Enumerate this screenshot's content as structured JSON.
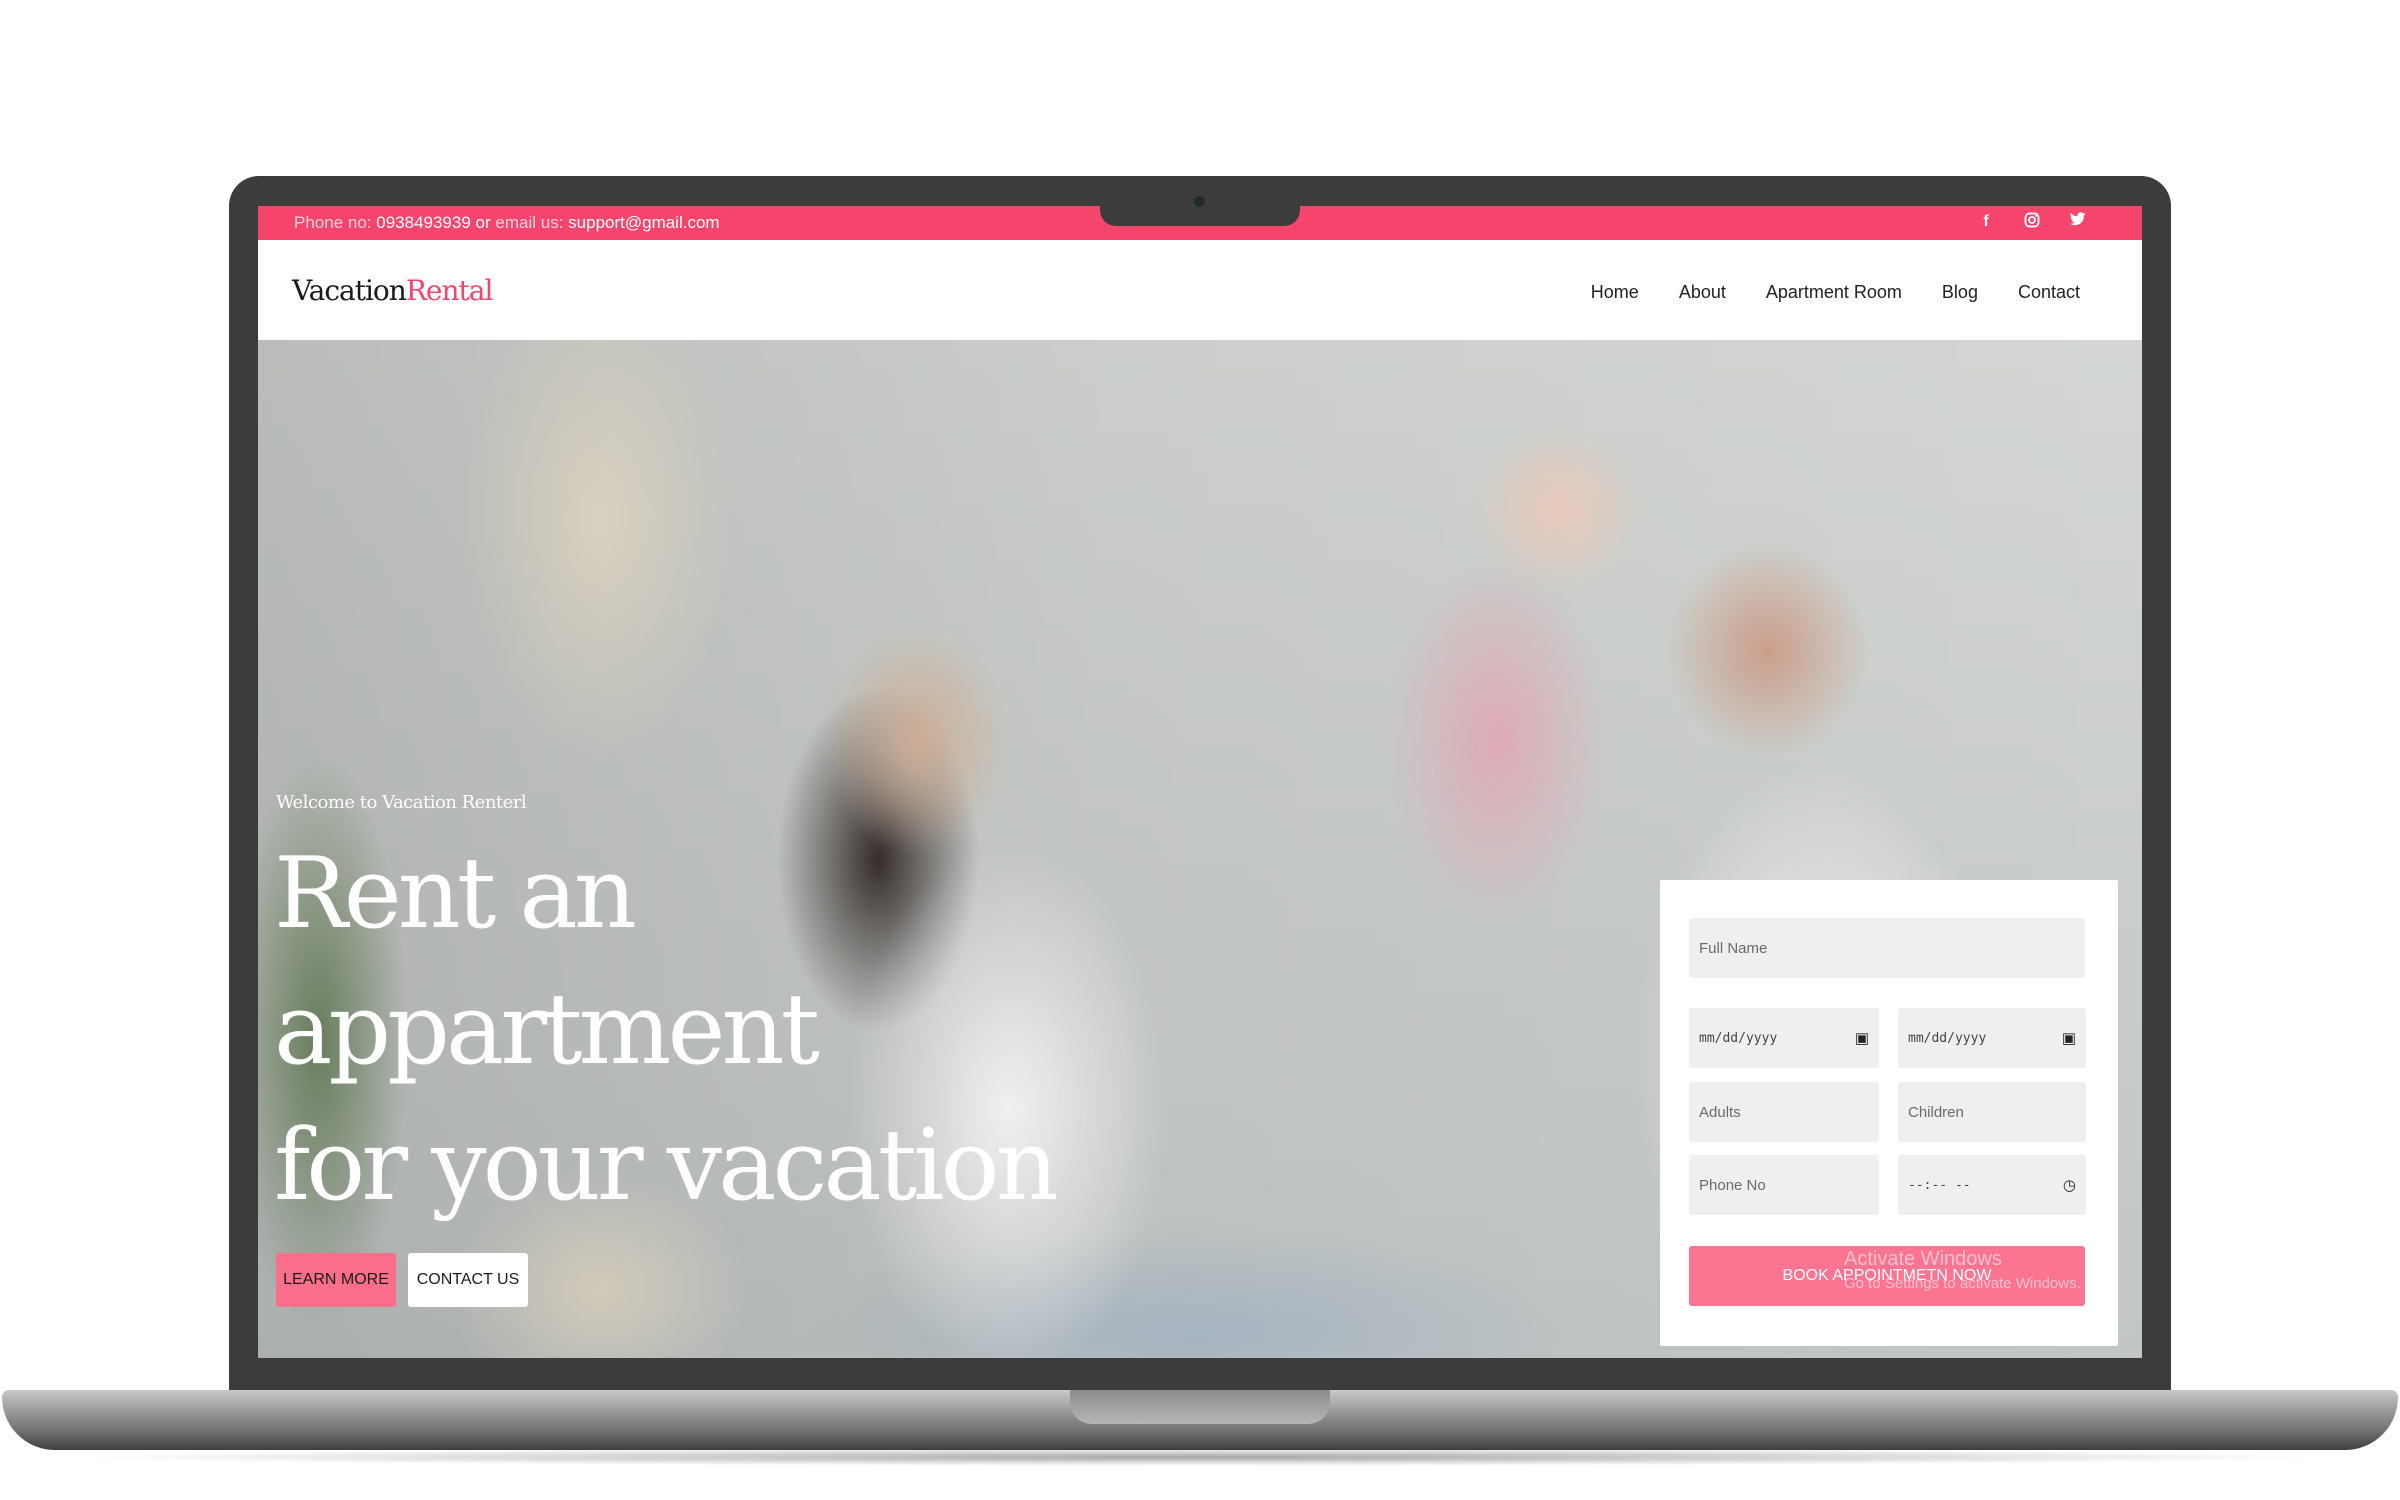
{
  "topbar": {
    "phone_label": "Phone no:",
    "phone": "0938493939",
    "or_text": "or",
    "email_label": "email us:",
    "email": "support@gmail.com",
    "social": [
      "facebook-icon",
      "instagram-icon",
      "twitter-icon"
    ]
  },
  "header": {
    "logo_main": "Vacation",
    "logo_accent": "Rental",
    "nav": [
      "Home",
      "About",
      "Apartment Room",
      "Blog",
      "Contact"
    ]
  },
  "hero": {
    "welcome": "Welcome to Vacation Renterl",
    "headline_line1": "Rent an appartment",
    "headline_line2": "for your vacation",
    "learn_more": "LEARN MORE",
    "contact_us": "CONTACT US"
  },
  "booking": {
    "full_name_placeholder": "Full Name",
    "date_placeholder": "mm/dd/yyyy",
    "adults_placeholder": "Adults",
    "children_placeholder": "Children",
    "phone_placeholder": "Phone No",
    "time_placeholder": "--:-- --",
    "submit_label": "BOOK APPOINTMETN NOW"
  },
  "watermark": {
    "line1": "Activate Windows",
    "line2": "Go to Settings to activate Windows."
  },
  "colors": {
    "accent": "#f5456c",
    "button_pink": "#fb7592",
    "bezel": "#3c3c3c"
  }
}
